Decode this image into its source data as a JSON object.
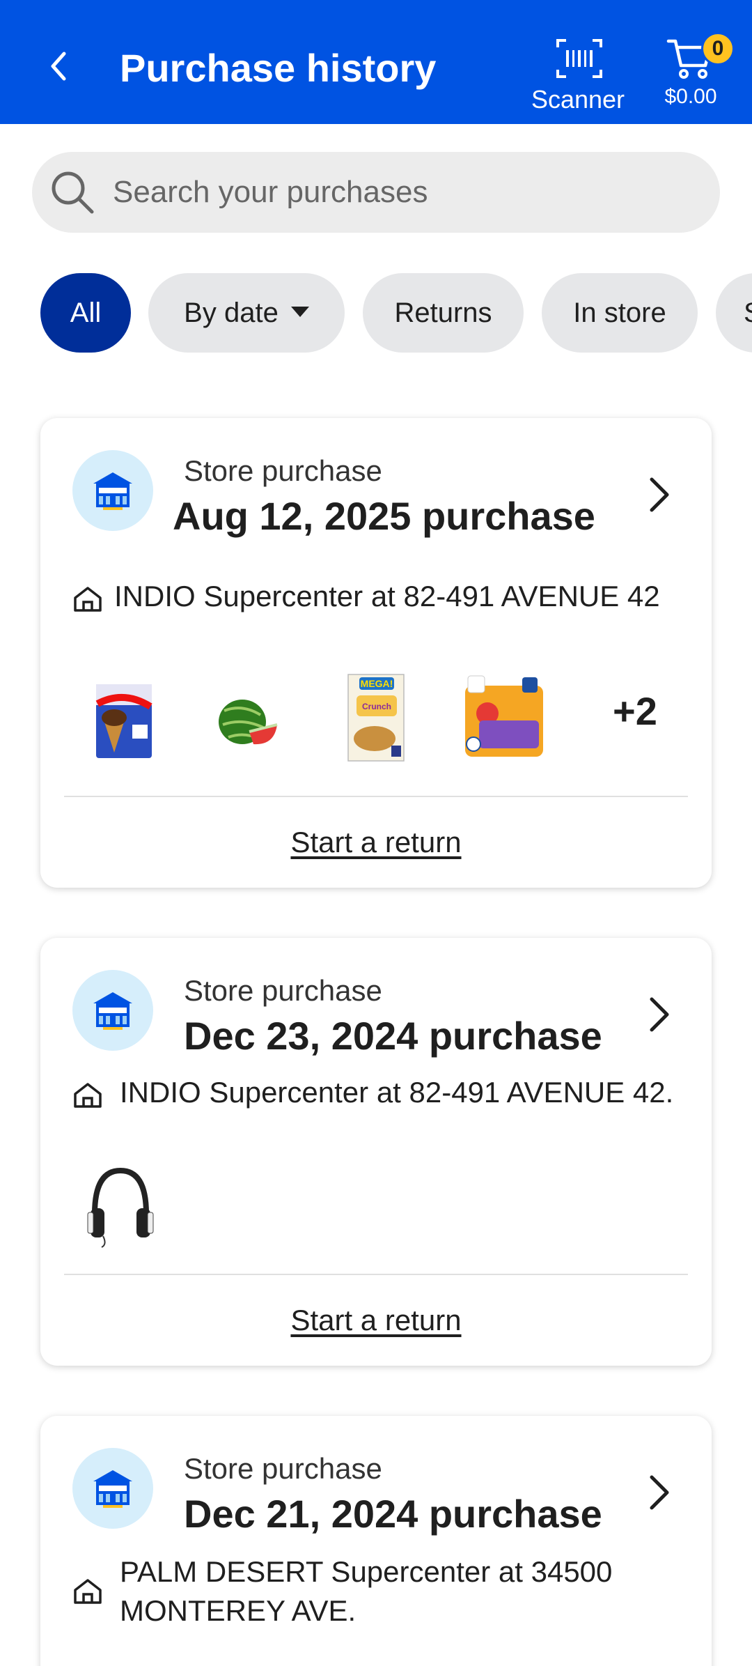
{
  "header": {
    "title": "Purchase history",
    "scanner_label": "Scanner",
    "cart_price": "$0.00",
    "cart_count": "0",
    "brand_color": "#0053e2"
  },
  "search": {
    "placeholder": "Search your purchases"
  },
  "filters": [
    "All",
    "By date",
    "Returns",
    "In store",
    "S"
  ],
  "orders": [
    {
      "kind": "Store purchase",
      "date": "Aug 12, 2025 purchase",
      "location": "INDIO Supercenter at 82-491 AVENUE 42",
      "items": [
        "drumstick-ice-cream",
        "watermelon",
        "cinnamon-toast-crunch-cereal",
        "arm-hammer-detergent"
      ],
      "more": "+2",
      "action": "Start a return"
    },
    {
      "kind": "Store purchase",
      "date": "Dec 23, 2024 purchase",
      "location": "INDIO Supercenter at 82-491 AVENUE 42.",
      "items": [
        "headphones"
      ],
      "action": "Start a return"
    },
    {
      "kind": "Store purchase",
      "date": "Dec 21, 2024 purchase",
      "location": "PALM DESERT Supercenter at 34500 MONTEREY AVE."
    }
  ]
}
